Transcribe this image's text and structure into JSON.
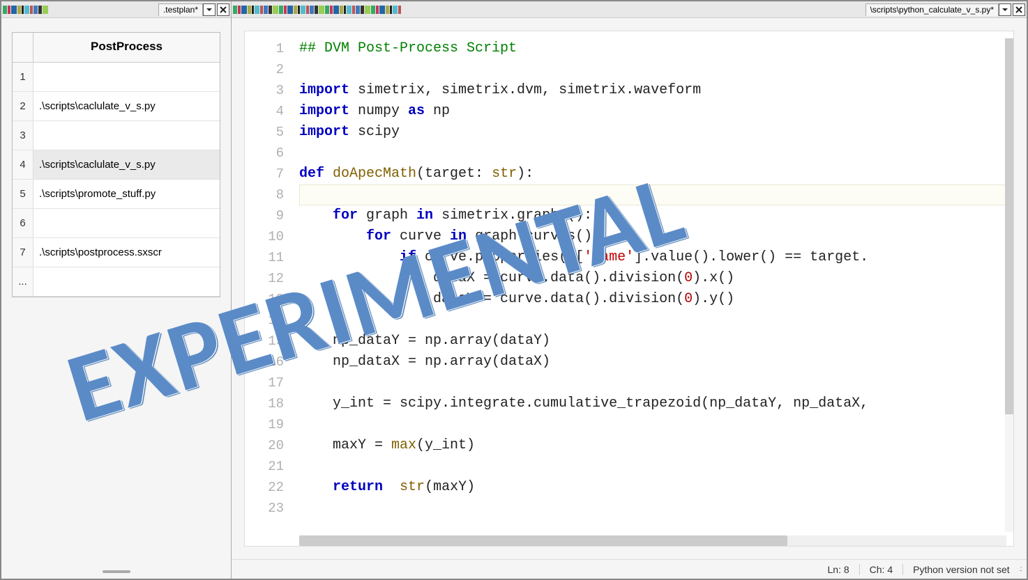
{
  "left_panel": {
    "tab_title": ".testplan*",
    "table_header": "PostProcess",
    "rows": [
      {
        "n": "1",
        "v": ""
      },
      {
        "n": "2",
        "v": ".\\scripts\\caclulate_v_s.py"
      },
      {
        "n": "3",
        "v": ""
      },
      {
        "n": "4",
        "v": ".\\scripts\\caclulate_v_s.py"
      },
      {
        "n": "5",
        "v": ".\\scripts\\promote_stuff.py"
      },
      {
        "n": "6",
        "v": ""
      },
      {
        "n": "7",
        "v": ".\\scripts\\postprocess.sxscr"
      },
      {
        "n": "...",
        "v": ""
      }
    ],
    "selected_row": 3
  },
  "right_panel": {
    "tab_title": "\\scripts\\python_calculate_v_s.py*",
    "code": [
      {
        "ln": 1,
        "t": "comment",
        "text": "## DVM Post-Process Script"
      },
      {
        "ln": 2,
        "t": "blank",
        "text": ""
      },
      {
        "ln": 3,
        "t": "import",
        "kw": "import",
        "rest": " simetrix, simetrix.dvm, simetrix.waveform"
      },
      {
        "ln": 4,
        "t": "importas",
        "kw": "import",
        "mod": " numpy ",
        "as": "as",
        "alias": " np"
      },
      {
        "ln": 5,
        "t": "import",
        "kw": "import",
        "rest": " scipy"
      },
      {
        "ln": 6,
        "t": "blank",
        "text": ""
      },
      {
        "ln": 7,
        "t": "def",
        "kw": "def",
        "name": " doApecMath",
        "sig": "(target: ",
        "type": "str",
        "close": "):"
      },
      {
        "ln": 8,
        "t": "current",
        "text": ""
      },
      {
        "ln": 9,
        "t": "for1",
        "indent": "    ",
        "kw": "for",
        "var": " graph ",
        "in": "in",
        "expr": " simetrix.graphs():"
      },
      {
        "ln": 10,
        "t": "for2",
        "indent": "        ",
        "kw": "for",
        "var": " curve ",
        "in": "in",
        "expr": " graph.curves():"
      },
      {
        "ln": 11,
        "t": "if",
        "indent": "            ",
        "kw": "if",
        "expr_a": " curve.properties()[",
        "str": "'name'",
        "expr_b": "].value().lower() == target."
      },
      {
        "ln": 12,
        "t": "assign",
        "indent": "                ",
        "lhs": "dataX = curve.data().division(",
        "num": "0",
        "rhs": ").x()"
      },
      {
        "ln": 13,
        "t": "assign",
        "indent": "                ",
        "lhs": "dataY = curve.data().division(",
        "num": "0",
        "rhs": ").y()"
      },
      {
        "ln": 14,
        "t": "blank",
        "text": ""
      },
      {
        "ln": 15,
        "t": "plain",
        "indent": "    ",
        "text": "np_dataY = np.array(dataY)"
      },
      {
        "ln": 16,
        "t": "plain",
        "indent": "    ",
        "text": "np_dataX = np.array(dataX)"
      },
      {
        "ln": 17,
        "t": "blank",
        "text": ""
      },
      {
        "ln": 18,
        "t": "plain",
        "indent": "    ",
        "text": "y_int = scipy.integrate.cumulative_trapezoid(np_dataY, np_dataX,"
      },
      {
        "ln": 19,
        "t": "blank",
        "text": ""
      },
      {
        "ln": 20,
        "t": "max",
        "indent": "    ",
        "lhs": "maxY = ",
        "fn": "max",
        "args": "(y_int)"
      },
      {
        "ln": 21,
        "t": "blank",
        "text": ""
      },
      {
        "ln": 22,
        "t": "return",
        "indent": "    ",
        "kw": "return",
        "rest": "  ",
        "fn": "str",
        "args": "(maxY)"
      },
      {
        "ln": 23,
        "t": "blank",
        "text": ""
      }
    ],
    "current_line_index": 7,
    "status": {
      "line": "Ln: 8",
      "col": "Ch: 4",
      "python": "Python version not set"
    }
  },
  "watermark": "EXPERIMENTAL"
}
